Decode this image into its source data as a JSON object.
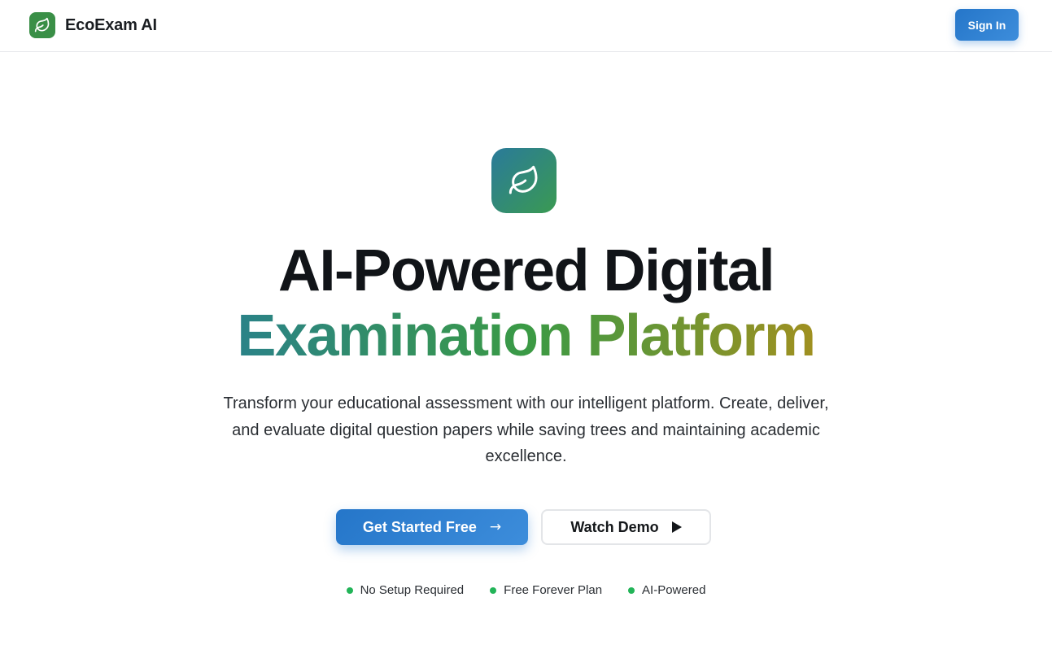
{
  "brand": {
    "name": "EcoExam AI",
    "logo_icon": "leaf-icon",
    "logo_color": "#3a8f47"
  },
  "nav": {
    "signin_label": "Sign In"
  },
  "hero": {
    "icon": "leaf-icon",
    "headline_line1": "AI-Powered Digital",
    "headline_line2": "Examination Platform",
    "subtitle": "Transform your educational assessment with our intelligent platform. Create, deliver, and evaluate digital question papers while saving trees and maintaining academic excellence.",
    "primary_cta": {
      "label": "Get Started Free",
      "icon": "arrow-right-icon",
      "glyph": "→"
    },
    "secondary_cta": {
      "label": "Watch Demo",
      "icon": "play-icon"
    },
    "features": [
      {
        "label": "No Setup Required"
      },
      {
        "label": "Free Forever Plan"
      },
      {
        "label": "AI-Powered"
      }
    ]
  },
  "colors": {
    "accent_blue": "#2f82d3",
    "headline_gradient_start": "#2a8288",
    "headline_gradient_mid": "#3a9a45",
    "headline_gradient_end": "#a09020",
    "feature_dot": "#22b458"
  }
}
